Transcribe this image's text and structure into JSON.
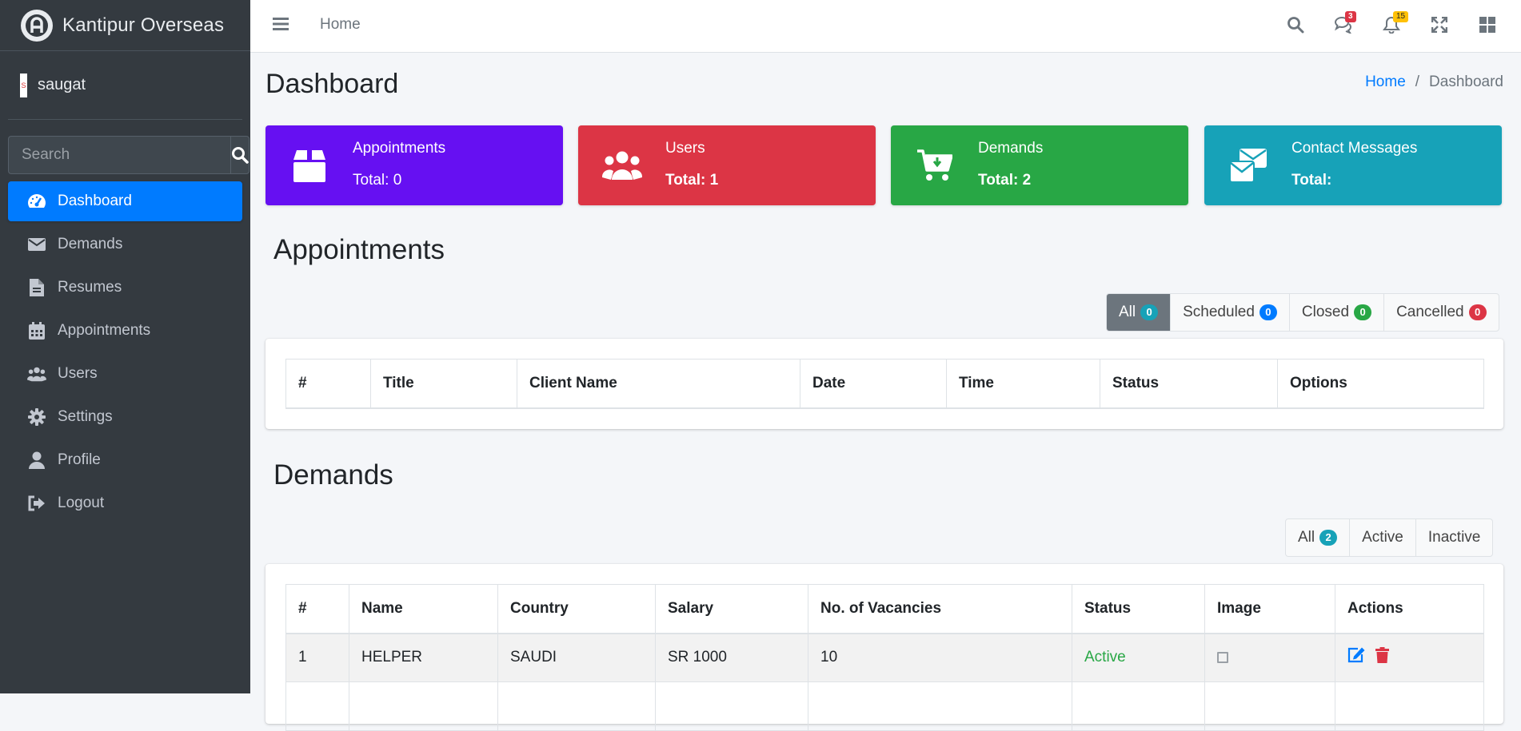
{
  "brand": {
    "name": "Kantipur Overseas"
  },
  "user": {
    "initial": "S",
    "name": "saugat"
  },
  "sidebar": {
    "search_placeholder": "Search",
    "items": [
      {
        "label": "Dashboard",
        "icon": "tachometer-icon",
        "active": true
      },
      {
        "label": "Demands",
        "icon": "envelope-icon"
      },
      {
        "label": "Resumes",
        "icon": "file-icon"
      },
      {
        "label": "Appointments",
        "icon": "calendar-icon"
      },
      {
        "label": "Users",
        "icon": "users-icon"
      },
      {
        "label": "Settings",
        "icon": "gear-icon"
      },
      {
        "label": "Profile",
        "icon": "user-icon"
      },
      {
        "label": "Logout",
        "icon": "sign-out-icon"
      }
    ]
  },
  "topbar": {
    "home_label": "Home",
    "messages_count": "3",
    "notifications_count": "15"
  },
  "page": {
    "title": "Dashboard"
  },
  "breadcrumb": {
    "home": "Home",
    "separator": "/",
    "current": "Dashboard"
  },
  "info_boxes": [
    {
      "label": "Appointments",
      "value": "Total: 0",
      "color": "#6610f2",
      "icon": "box-icon"
    },
    {
      "label": "Users",
      "value": "Total: 1",
      "color": "#dc3545",
      "icon": "users-icon"
    },
    {
      "label": "Demands",
      "value": "Total: 2",
      "color": "#28a745",
      "icon": "cart-download-icon"
    },
    {
      "label": "Contact Messages",
      "value": "Total:",
      "color": "#17a2b8",
      "icon": "envelopes-icon"
    }
  ],
  "appointments": {
    "title": "Appointments",
    "filters": [
      {
        "label": "All",
        "count": "0",
        "badge_color": "#17a2b8"
      },
      {
        "label": "Scheduled",
        "count": "0",
        "badge_color": "#007bff"
      },
      {
        "label": "Closed",
        "count": "0",
        "badge_color": "#28a745"
      },
      {
        "label": "Cancelled",
        "count": "0",
        "badge_color": "#dc3545"
      }
    ],
    "columns": [
      "#",
      "Title",
      "Client Name",
      "Date",
      "Time",
      "Status",
      "Options"
    ]
  },
  "demands": {
    "title": "Demands",
    "filters": [
      {
        "label": "All",
        "count": "2",
        "badge_color": "#17a2b8"
      },
      {
        "label": "Active"
      },
      {
        "label": "Inactive"
      }
    ],
    "columns": [
      "#",
      "Name",
      "Country",
      "Salary",
      "No. of Vacancies",
      "Status",
      "Image",
      "Actions"
    ],
    "rows": [
      {
        "num": "1",
        "name": "HELPER",
        "country": "SAUDI",
        "salary": "SR 1000",
        "vacancies": "10",
        "status": "Active"
      }
    ]
  },
  "colors": {
    "sidebar_bg": "#343a40",
    "accent": "#007bff",
    "page_bg": "#f4f6f9"
  }
}
